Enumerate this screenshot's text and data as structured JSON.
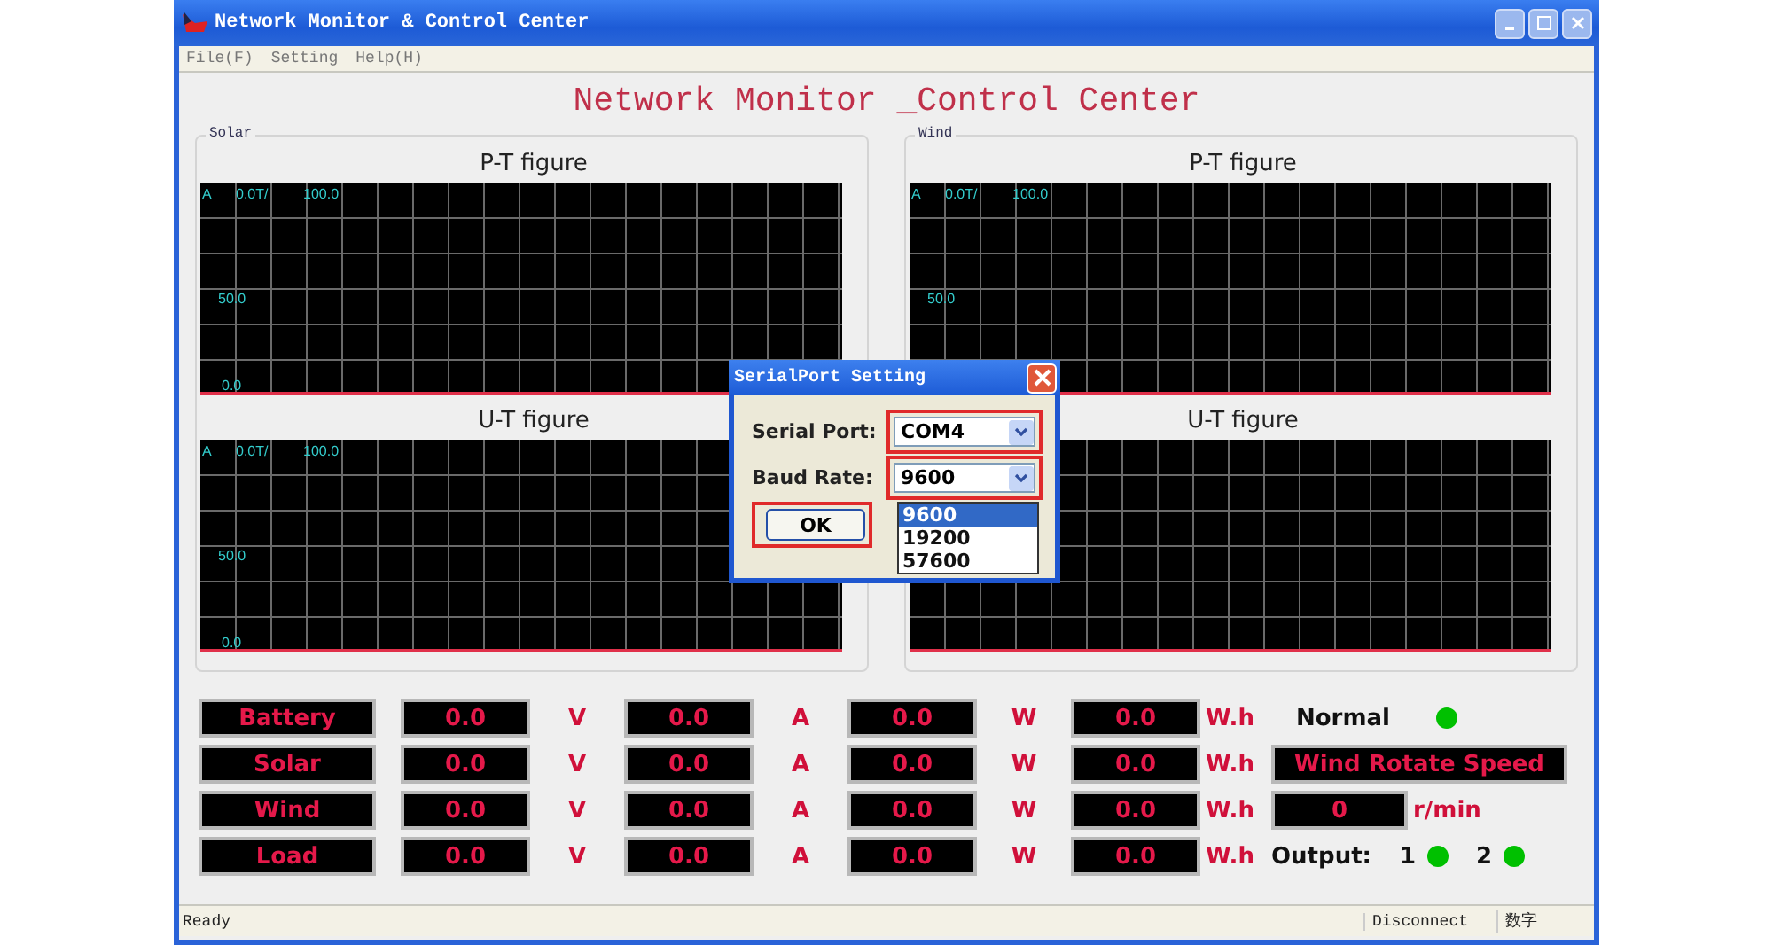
{
  "window": {
    "title": "Network Monitor & Control Center"
  },
  "menu": [
    {
      "label": "File(F)"
    },
    {
      "label": "Setting"
    },
    {
      "label": "Help(H)"
    }
  ],
  "heading": "Network Monitor _Control Center",
  "panels": [
    {
      "label": "Solar",
      "plots": [
        {
          "title": "P-T figure",
          "unit": "A",
          "start": "0.0T/",
          "end": "100.0",
          "mid": "50.0",
          "zero": "0.0"
        },
        {
          "title": "U-T figure",
          "unit": "A",
          "start": "0.0T/",
          "end": "100.0",
          "mid": "50.0",
          "zero": "0.0"
        }
      ]
    },
    {
      "label": "Wind",
      "plots": [
        {
          "title": "P-T figure",
          "unit": "A",
          "start": "0.0T/",
          "end": "100.0",
          "mid": "50.0"
        },
        {
          "title": "U-T figure"
        }
      ]
    }
  ],
  "meters": [
    {
      "label": "Battery",
      "volts": "0.0",
      "v_unit": "V",
      "amps": "0.0",
      "a_unit": "A",
      "watts": "0.0",
      "w_unit": "W",
      "energy": "0.0",
      "e_unit": "W.h"
    },
    {
      "label": "Solar",
      "volts": "0.0",
      "v_unit": "V",
      "amps": "0.0",
      "a_unit": "A",
      "watts": "0.0",
      "w_unit": "W",
      "energy": "0.0",
      "e_unit": "W.h"
    },
    {
      "label": "Wind",
      "volts": "0.0",
      "v_unit": "V",
      "amps": "0.0",
      "a_unit": "A",
      "watts": "0.0",
      "w_unit": "W",
      "energy": "0.0",
      "e_unit": "W.h"
    },
    {
      "label": "Load",
      "volts": "0.0",
      "v_unit": "V",
      "amps": "0.0",
      "a_unit": "A",
      "watts": "0.0",
      "w_unit": "W",
      "energy": "0.0",
      "e_unit": "W.h"
    }
  ],
  "status": {
    "label": "Normal",
    "color": "#00c000"
  },
  "wind_speed": {
    "label": "Wind Rotate Speed",
    "value": "0",
    "unit": "r/min"
  },
  "outputs": {
    "label": "Output:",
    "items": [
      {
        "label": "1",
        "color": "#00c000"
      },
      {
        "label": "2",
        "color": "#00c000"
      }
    ]
  },
  "dialog": {
    "title": "SerialPort Setting",
    "fields": [
      {
        "label": "Serial Port:",
        "value": "COM4",
        "highlighted": true
      },
      {
        "label": "Baud Rate:",
        "value": "9600",
        "highlighted": true
      }
    ],
    "options": [
      {
        "label": "9600",
        "selected": true
      },
      {
        "label": "19200",
        "selected": false
      },
      {
        "label": "57600",
        "selected": false
      }
    ],
    "ok": {
      "label": "OK",
      "highlighted": true
    }
  },
  "status_bar": [
    "Ready",
    "Disconnect",
    "数字"
  ]
}
